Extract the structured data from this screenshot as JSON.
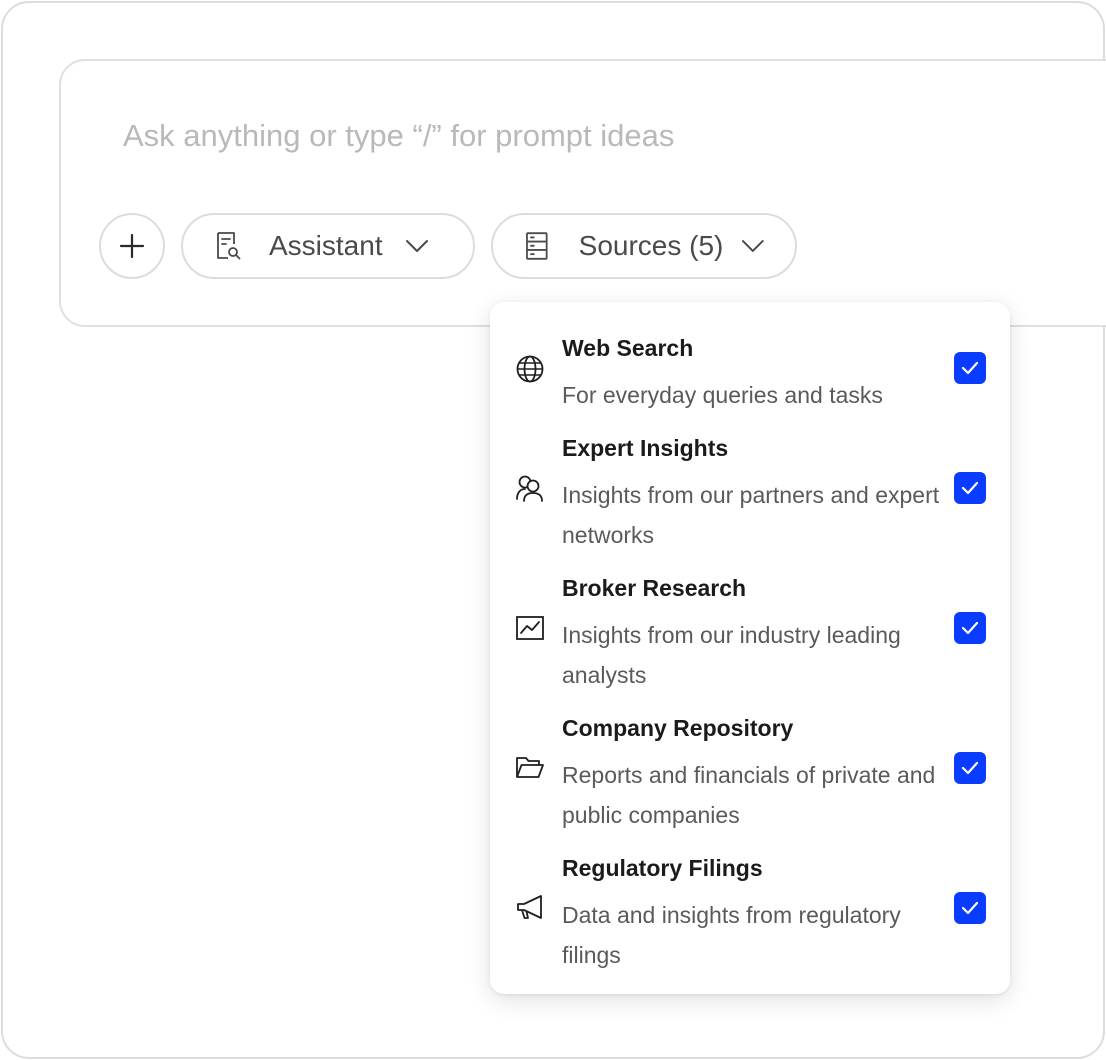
{
  "composer": {
    "placeholder": "Ask anything or type “/” for prompt ideas"
  },
  "toolbar": {
    "add_icon": "plus-icon",
    "assistant": {
      "icon": "document-search-icon",
      "label": "Assistant",
      "chevron": "chevron-down-icon"
    },
    "sources": {
      "icon": "database-icon",
      "label": "Sources (5)",
      "chevron": "chevron-down-icon"
    }
  },
  "sources_menu": {
    "items": [
      {
        "icon": "globe-icon",
        "title": "Web Search",
        "description": "For everyday queries and tasks",
        "checked": true
      },
      {
        "icon": "people-icon",
        "title": "Expert Insights",
        "description": "Insights from our partners and expert networks",
        "checked": true
      },
      {
        "icon": "line-chart-icon",
        "title": "Broker Research",
        "description": "Insights from our industry leading analysts",
        "checked": true
      },
      {
        "icon": "folder-open-icon",
        "title": "Company Repository",
        "description": "Reports and financials of private and public companies",
        "checked": true
      },
      {
        "icon": "megaphone-icon",
        "title": "Regulatory Filings",
        "description": "Data and insights from regulatory filings",
        "checked": true
      }
    ]
  },
  "colors": {
    "checkbox": "#0a3cff",
    "border": "#dcdcdc",
    "placeholder": "#b9b9b9"
  }
}
